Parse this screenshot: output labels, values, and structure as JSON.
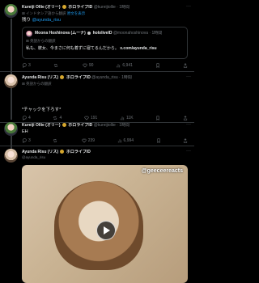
{
  "posts": [
    {
      "name": "Kureiji Ollie (オリー)",
      "tag": "ホロライブID",
      "handle": "@kureijiollie",
      "time": "1時間",
      "translated": "インドネシア語から翻訳",
      "show_original": "原文を表示",
      "text": "残り",
      "mention": "@ayunda_risu",
      "replies": "",
      "reposts": "",
      "likes": "",
      "views": ""
    },
    {
      "quote_name": "Moona Hoshinova (ムーナ)",
      "quote_tag": "hololiveID",
      "quote_handle": "@moonahoshinova",
      "quote_time": "1時間",
      "quote_translated": "英語からの翻訳",
      "quote_text": "私も、彼女、今まさに何も着ずに寝てるんだから。",
      "quote_link": "x.com/ayunda_risu",
      "replies": "3",
      "reposts": "",
      "likes": "90",
      "views": "6,941"
    },
    {
      "name": "Ayunda Risu (リス)",
      "tag": "ホロライブID",
      "handle": "@ayunda_risu",
      "time": "1時間",
      "translated": "英語からの翻訳",
      "text": "*チャックを下ろす*",
      "replies": "4",
      "reposts": "4",
      "likes": "191",
      "views": "11K"
    },
    {
      "name": "Kureiji Ollie (オリー)",
      "tag": "ホロライブID",
      "handle": "@kureijiollie",
      "time": "1時間",
      "text": "EH",
      "replies": "3",
      "reposts": "",
      "likes": "239",
      "views": "6,994"
    },
    {
      "name": "Ayunda Risu (リス)",
      "tag": "ホロライブID",
      "handle": "@ayunda_risu",
      "media_watermark": "@geeceereacts"
    }
  ]
}
